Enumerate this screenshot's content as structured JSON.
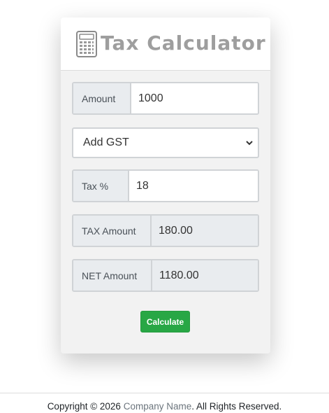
{
  "header": {
    "title": "Tax Calculator",
    "icon": "calculator-icon"
  },
  "form": {
    "amount_label": "Amount",
    "amount_value": "1000",
    "mode_selected": "Add GST",
    "tax_label": "Tax %",
    "tax_value": "18",
    "tax_amount_label": "TAX Amount",
    "tax_amount_value": "180.00",
    "net_amount_label": "NET Amount",
    "net_amount_value": "1180.00",
    "calculate_label": "Calculate"
  },
  "footer": {
    "copyright_prefix": "Copyright © 2026",
    "company_link": "Company Name",
    "suffix": ". All Rights Reserved."
  },
  "colors": {
    "button": "#28a745",
    "title_gray": "#9e9e9e",
    "link": "#6c757d",
    "card_bg": "#f2f2f2"
  }
}
